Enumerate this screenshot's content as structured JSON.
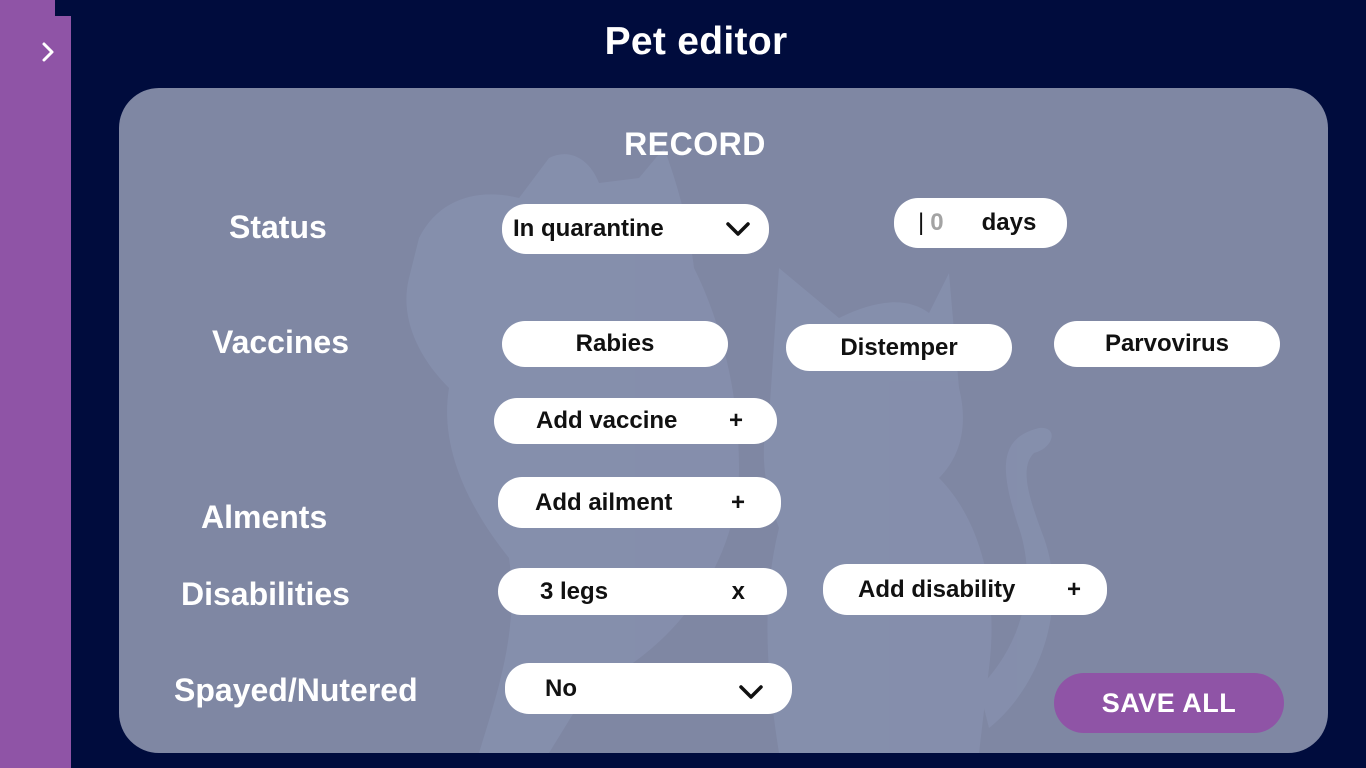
{
  "sidebar": {
    "toggle_icon": "chevron-right-icon",
    "color": "#8f54a6"
  },
  "header": {
    "title": "Pet editor"
  },
  "record": {
    "section_title": "RECORD",
    "status": {
      "label": "Status",
      "selected": "In quarantine",
      "days_value": "0",
      "days_unit": "days"
    },
    "vaccines": {
      "label": "Vaccines",
      "items": [
        "Rabies",
        "Distemper",
        "Parvovirus"
      ],
      "add_label": "Add vaccine",
      "add_icon": "+"
    },
    "ailments": {
      "label": "Alments",
      "add_label": "Add ailment",
      "add_icon": "+"
    },
    "disabilities": {
      "label": "Disabilities",
      "items": [
        {
          "label": "3 legs",
          "remove_icon": "x"
        }
      ],
      "add_label": "Add disability",
      "add_icon": "+"
    },
    "spayed": {
      "label": "Spayed/Nutered",
      "selected": "No"
    },
    "save_label": "SAVE ALL"
  },
  "colors": {
    "background": "#000c3d",
    "card": "#7f87a3",
    "accent": "#8f54a6",
    "pill": "#ffffff"
  }
}
